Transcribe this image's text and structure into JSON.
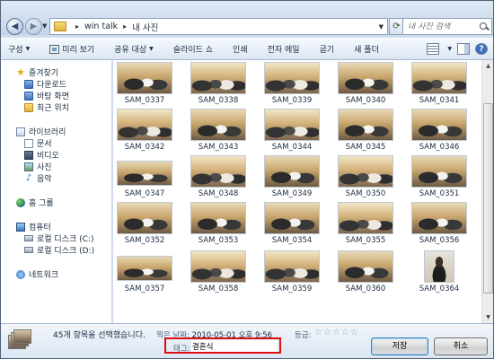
{
  "address": {
    "path": [
      "win talk",
      "내 사진"
    ],
    "search_placeholder": "내 사진 검색"
  },
  "toolbar": {
    "organize": "구성",
    "preview": "미리 보기",
    "share": "공유 대상",
    "slideshow": "슬라이드 쇼",
    "print": "인쇄",
    "email": "전자 메일",
    "burn": "굽기",
    "new_folder": "새 폴더"
  },
  "nav": {
    "favorites": {
      "label": "즐겨찾기",
      "items": [
        "다운로드",
        "바탕 화면",
        "최근 위치"
      ]
    },
    "libraries": {
      "label": "라이브러리",
      "items": [
        "문서",
        "비디오",
        "사진",
        "음악"
      ]
    },
    "homegroup": {
      "label": "홈 그룹"
    },
    "computer": {
      "label": "컴퓨터",
      "items": [
        "로컬 디스크 (C:)",
        "로컬 디스크 (D:)"
      ]
    },
    "network": {
      "label": "네트워크"
    }
  },
  "files": [
    "SAM_0337",
    "SAM_0338",
    "SAM_0339",
    "SAM_0340",
    "SAM_0341",
    "SAM_0342",
    "SAM_0343",
    "SAM_0344",
    "SAM_0345",
    "SAM_0346",
    "SAM_0347",
    "SAM_0348",
    "SAM_0349",
    "SAM_0350",
    "SAM_0351",
    "SAM_0352",
    "SAM_0353",
    "SAM_0354",
    "SAM_0355",
    "SAM_0356",
    "SAM_0357",
    "SAM_0358",
    "SAM_0359",
    "SAM_0360",
    "SAM_0364"
  ],
  "details": {
    "selection": "45개 항목을 선택했습니다.",
    "date_label": "찍은 날짜:",
    "date_value": "2010-05-01 오후 9:56",
    "rating_label": "등급:",
    "rating_value": 0,
    "rating_stars": "☆☆☆☆☆",
    "tag_label": "태그:",
    "tag_value": "결혼식"
  },
  "buttons": {
    "save": "저장",
    "cancel": "취소"
  }
}
